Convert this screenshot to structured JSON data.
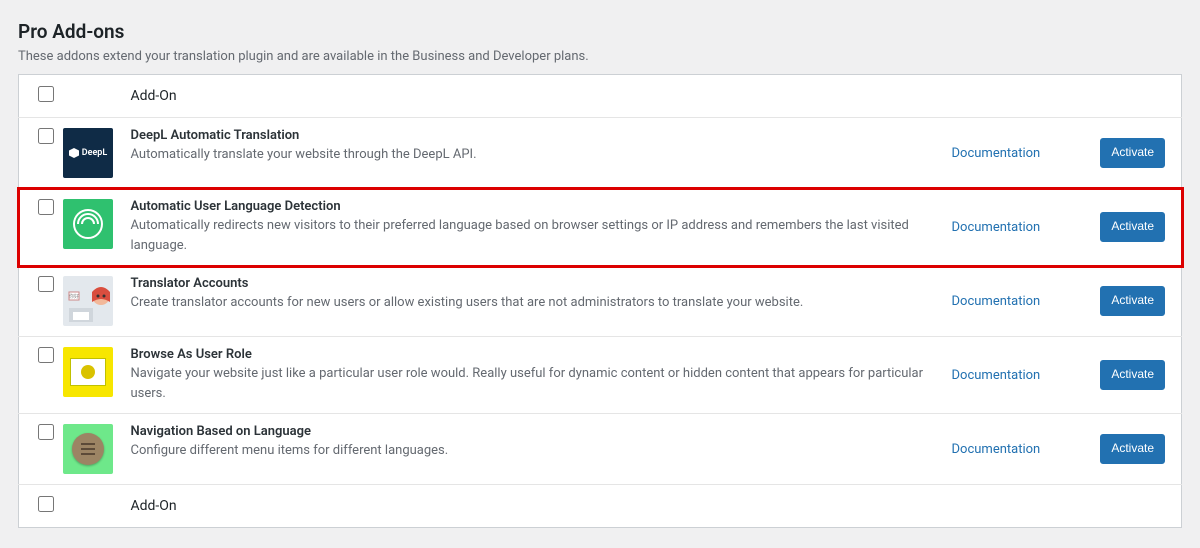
{
  "section": {
    "title": "Pro Add-ons",
    "subtitle": "These addons extend your translation plugin and are available in the Business and Developer plans."
  },
  "table": {
    "header_label": "Add-On",
    "footer_label": "Add-On",
    "documentation_label": "Documentation",
    "activate_label": "Activate"
  },
  "addons": [
    {
      "title": "DeepL Automatic Translation",
      "description": "Automatically translate your website through the DeepL API.",
      "highlighted": false,
      "icon": "deepl"
    },
    {
      "title": "Automatic User Language Detection",
      "description": "Automatically redirects new visitors to their preferred language based on browser settings or IP address and remembers the last visited language.",
      "highlighted": true,
      "icon": "radar"
    },
    {
      "title": "Translator Accounts",
      "description": "Create translator accounts for new users or allow existing users that are not administrators to translate your website.",
      "highlighted": false,
      "icon": "avatar"
    },
    {
      "title": "Browse As User Role",
      "description": "Navigate your website just like a particular user role would. Really useful for dynamic content or hidden content that appears for particular users.",
      "highlighted": false,
      "icon": "browse"
    },
    {
      "title": "Navigation Based on Language",
      "description": "Configure different menu items for different languages.",
      "highlighted": false,
      "icon": "menu"
    }
  ]
}
